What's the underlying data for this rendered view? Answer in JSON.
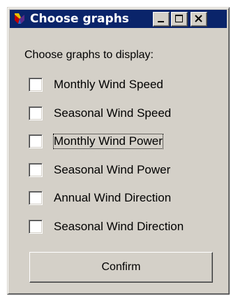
{
  "window": {
    "title": "Choose graphs",
    "icon": "app-icon",
    "controls": [
      "minimize-icon",
      "maximize-icon",
      "close-icon"
    ]
  },
  "prompt": "Choose graphs to display:",
  "options": [
    {
      "label": "Monthly Wind Speed",
      "checked": false
    },
    {
      "label": "Seasonal Wind Speed",
      "checked": false
    },
    {
      "label": "Monthly Wind Power",
      "checked": false,
      "focused": true
    },
    {
      "label": "Seasonal Wind Power",
      "checked": false
    },
    {
      "label": "Annual Wind Direction",
      "checked": false
    },
    {
      "label": "Seasonal Wind Direction",
      "checked": false
    }
  ],
  "confirm_label": "Confirm",
  "colors": {
    "titlebar": "#0a246a",
    "window_face": "#d4d0c8",
    "title_text": "#ffffff"
  }
}
